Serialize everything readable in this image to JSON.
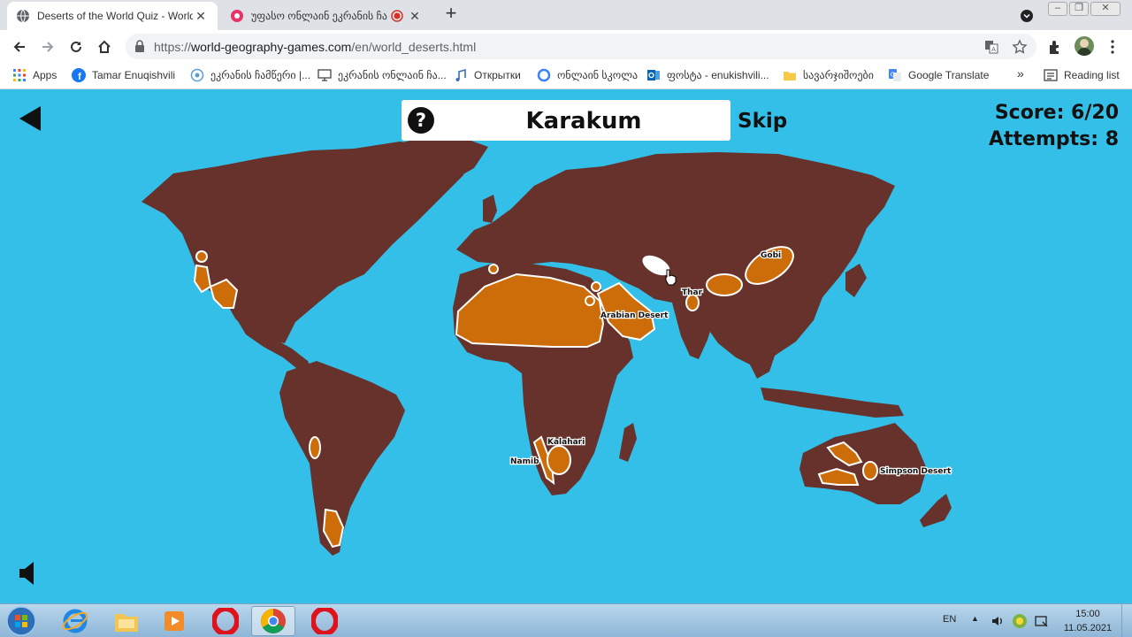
{
  "browser": {
    "tabs": [
      {
        "title": "Deserts of the World Quiz - World",
        "icon": "globe-icon",
        "active": true
      },
      {
        "title": "უფასო ონლაინ ეკრანის ჩაწ",
        "icon": "screen-recorder-icon",
        "active": false
      }
    ],
    "url_prefix": "https://",
    "url_domain": "world-geography-games.com",
    "url_path": "/en/world_deserts.html"
  },
  "bookmarks": [
    {
      "label": "Apps",
      "icon": "apps-grid-icon"
    },
    {
      "label": "Tamar Enuqishvili",
      "icon": "facebook-icon"
    },
    {
      "label": "ეკრანის ჩამწერი |...",
      "icon": "record-icon"
    },
    {
      "label": "ეკრანის ონლაინ ჩა...",
      "icon": "monitor-icon"
    },
    {
      "label": "Открытки",
      "icon": "music-note-icon"
    },
    {
      "label": "ონლაინ სკოლა",
      "icon": "circle-icon"
    },
    {
      "label": "ფოსტა - enukishvili...",
      "icon": "outlook-icon"
    },
    {
      "label": "სავარჯიშოები",
      "icon": "folder-icon"
    },
    {
      "label": "Google Translate",
      "icon": "translate-icon"
    }
  ],
  "bookmarks_overflow": "»",
  "reading_list": "Reading list",
  "game": {
    "target": "Karakum",
    "skip": "Skip",
    "score": "Score: 6/20",
    "attempts": "Attempts: 8",
    "deserts": [
      {
        "name": "Gobi",
        "found": true
      },
      {
        "name": "Thar",
        "found": true
      },
      {
        "name": "Arabian Desert",
        "found": true
      },
      {
        "name": "Kalahari",
        "found": true
      },
      {
        "name": "Namib",
        "found": true
      },
      {
        "name": "Simpson Desert",
        "found": true
      }
    ],
    "colors": {
      "ocean": "#33bfe8",
      "land": "#66322b",
      "desert": "#cc6d0a",
      "highlight": "#ffffff"
    }
  },
  "taskbar": {
    "apps": [
      "start-orb",
      "internet-explorer",
      "file-explorer",
      "media-player",
      "opera",
      "chrome",
      "opera"
    ],
    "language": "EN",
    "time": "15:00",
    "date": "11.05.2021"
  }
}
